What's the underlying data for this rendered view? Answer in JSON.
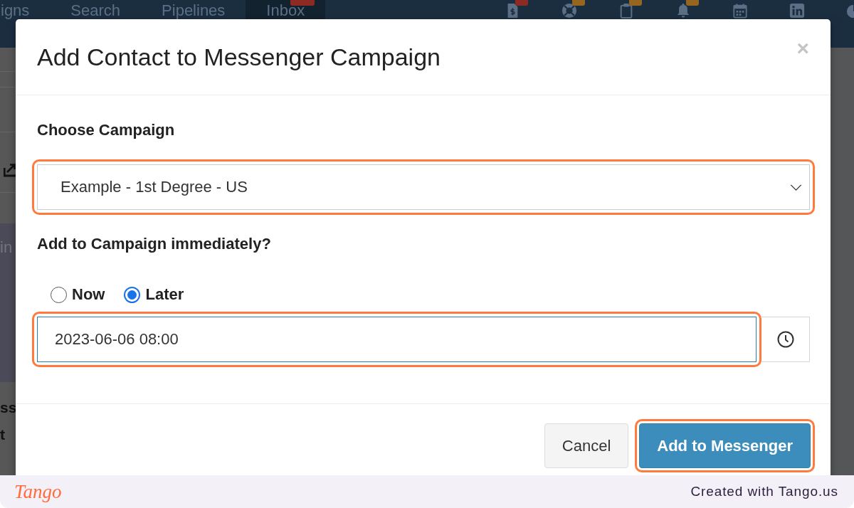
{
  "nav": {
    "tabs": [
      {
        "label": "igns",
        "selected": false
      },
      {
        "label": "Search",
        "selected": false
      },
      {
        "label": "Pipelines",
        "selected": false
      },
      {
        "label": "Inbox",
        "selected": true,
        "badge": {
          "color": "#8e2a24"
        }
      }
    ],
    "icons": [
      {
        "kind": "invoice",
        "color": "#8e2a24"
      },
      {
        "kind": "lifebuoy",
        "color": "#94661e"
      },
      {
        "kind": "clipboard",
        "color": "#94661e"
      },
      {
        "kind": "bell",
        "color": "#94661e"
      },
      {
        "kind": "calendar"
      },
      {
        "kind": "linkedin"
      },
      {
        "kind": "pie"
      }
    ]
  },
  "page_edge": {
    "items": [
      {
        "kind": "export"
      },
      {
        "kind": "panel",
        "text": "in"
      },
      {
        "kind": "text",
        "text": "ss"
      },
      {
        "kind": "text",
        "text": "t"
      }
    ]
  },
  "modal": {
    "title": "Add Contact to Messenger Campaign",
    "close": "×",
    "fields": [
      {
        "kind": "select",
        "label": "Choose Campaign",
        "value": "Example - 1st Degree - US",
        "highlighted": true
      },
      {
        "kind": "schedule",
        "label": "Add to Campaign immediately?",
        "options": [
          {
            "label": "Now",
            "selected": false
          },
          {
            "label": "Later",
            "selected": true
          }
        ],
        "value": "2023-06-06 08:00",
        "focused": true,
        "highlighted": true
      }
    ],
    "buttons": [
      {
        "kind": "secondary",
        "label": "Cancel",
        "highlighted": false
      },
      {
        "kind": "primary",
        "label": "Add to Messenger",
        "highlighted": true
      }
    ]
  },
  "footer": {
    "logo": "Tango",
    "credit": "Created with Tango.us"
  }
}
